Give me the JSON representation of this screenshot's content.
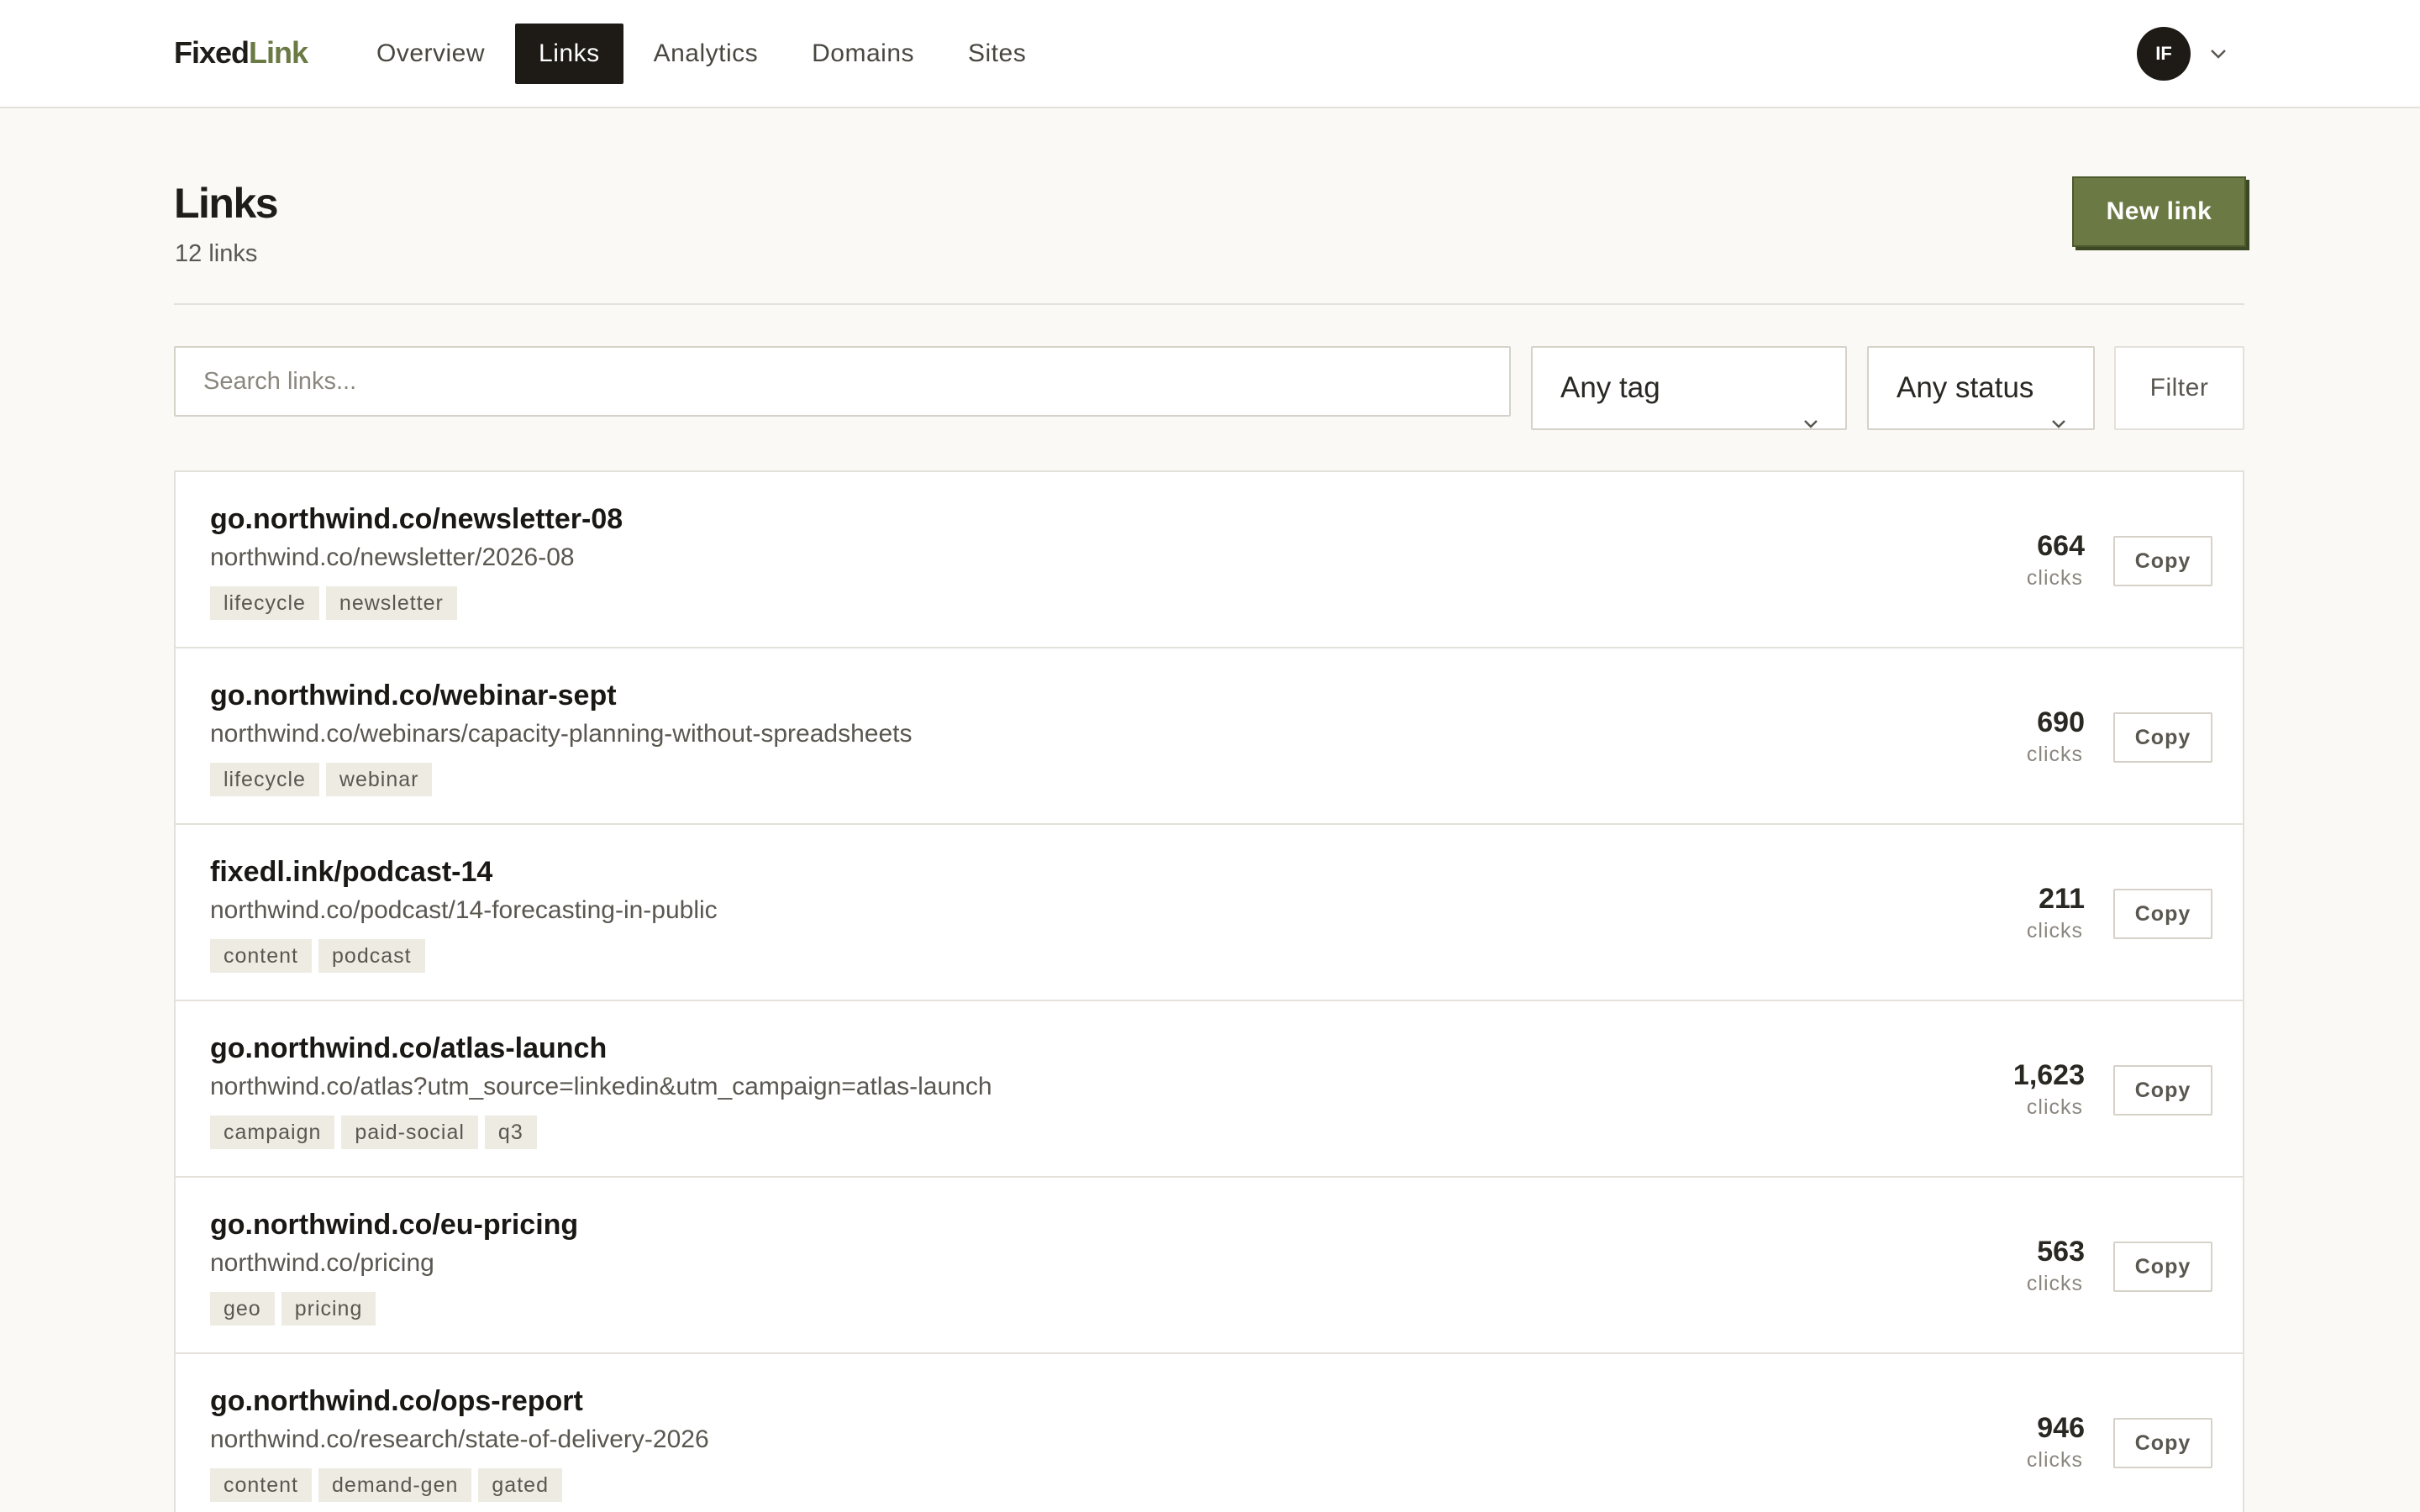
{
  "app": {
    "logo_part1": "Fixed",
    "logo_part2": "Link",
    "nav": [
      {
        "label": "Overview",
        "active": false
      },
      {
        "label": "Links",
        "active": true
      },
      {
        "label": "Analytics",
        "active": false
      },
      {
        "label": "Domains",
        "active": false
      },
      {
        "label": "Sites",
        "active": false
      }
    ],
    "avatar_initials": "IF",
    "avatar_menu_icon": "chevron-down-icon"
  },
  "header": {
    "title": "Links",
    "subtitle": "12 links",
    "new_link_label": "New link"
  },
  "filters": {
    "search_placeholder": "Search links...",
    "tag_select": "Any tag",
    "status_select": "Any status",
    "filter_label": "Filter"
  },
  "links": [
    {
      "short": "go.northwind.co/newsletter-08",
      "destination": "northwind.co/newsletter/2026-08",
      "tags": [
        "lifecycle",
        "newsletter"
      ],
      "clicks": "664",
      "clicks_label": "clicks",
      "copy_label": "Copy"
    },
    {
      "short": "go.northwind.co/webinar-sept",
      "destination": "northwind.co/webinars/capacity-planning-without-spreadsheets",
      "tags": [
        "lifecycle",
        "webinar"
      ],
      "clicks": "690",
      "clicks_label": "clicks",
      "copy_label": "Copy"
    },
    {
      "short": "fixedl.ink/podcast-14",
      "destination": "northwind.co/podcast/14-forecasting-in-public",
      "tags": [
        "content",
        "podcast"
      ],
      "clicks": "211",
      "clicks_label": "clicks",
      "copy_label": "Copy"
    },
    {
      "short": "go.northwind.co/atlas-launch",
      "destination": "northwind.co/atlas?utm_source=linkedin&utm_campaign=atlas-launch",
      "tags": [
        "campaign",
        "paid-social",
        "q3"
      ],
      "clicks": "1,623",
      "clicks_label": "clicks",
      "copy_label": "Copy"
    },
    {
      "short": "go.northwind.co/eu-pricing",
      "destination": "northwind.co/pricing",
      "tags": [
        "geo",
        "pricing"
      ],
      "clicks": "563",
      "clicks_label": "clicks",
      "copy_label": "Copy"
    },
    {
      "short": "go.northwind.co/ops-report",
      "destination": "northwind.co/research/state-of-delivery-2026",
      "tags": [
        "content",
        "demand-gen",
        "gated"
      ],
      "clicks": "946",
      "clicks_label": "clicks",
      "copy_label": "Copy"
    }
  ],
  "colors": {
    "accent": "#6b7a44",
    "nav_active": "#1e1b17",
    "background": "#faf9f6",
    "border": "#e4e1da"
  }
}
